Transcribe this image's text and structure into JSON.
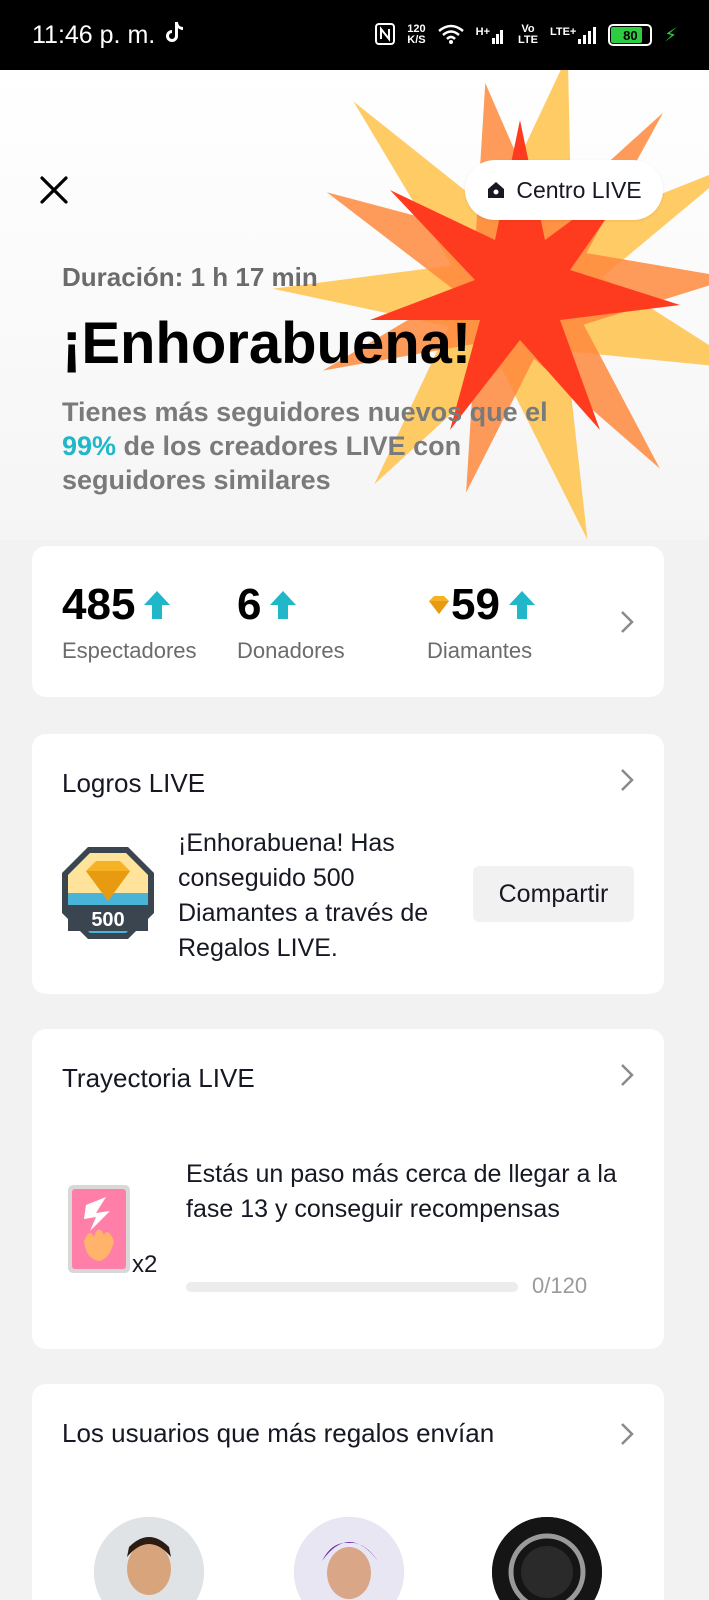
{
  "status_bar": {
    "time": "11:46 p. m.",
    "net_speed_value": "120",
    "net_speed_unit": "K/S",
    "signal1_label": "H+",
    "signal2_top": "Vo",
    "signal2_bottom": "LTE",
    "signal3_label": "LTE+",
    "battery_level": "80"
  },
  "header": {
    "live_center_label": "Centro LIVE",
    "duration": "Duración: 1 h 17 min",
    "title": "¡Enhorabuena!",
    "subtitle_before": "Tienes más seguidores nuevos que el ",
    "subtitle_pct": "99%",
    "subtitle_after": " de los creadores LIVE con seguidores similares"
  },
  "stats": {
    "viewers_value": "485",
    "viewers_label": "Espectadores",
    "donors_value": "6",
    "donors_label": "Donadores",
    "diamonds_value": "59",
    "diamonds_label": "Diamantes"
  },
  "achievements": {
    "title": "Logros LIVE",
    "badge_number": "500",
    "description": "¡Enhorabuena! Has conseguido 500 Diamantes a través de Regalos LIVE.",
    "share_label": "Compartir"
  },
  "trajectory": {
    "title": "Trayectoria LIVE",
    "multiplier": "x2",
    "description": "Estás un paso más cerca de llegar a la fase 13 y conseguir recompensas",
    "progress_text": "0/120",
    "progress_fraction": 0
  },
  "top_gifters": {
    "title": "Los usuarios que más regalos envían"
  },
  "colors": {
    "accent_teal": "#20b8c8",
    "burst_red": "#ff3b1f",
    "burst_orange": "#ff8a3d",
    "burst_yellow": "#ffc24a"
  }
}
